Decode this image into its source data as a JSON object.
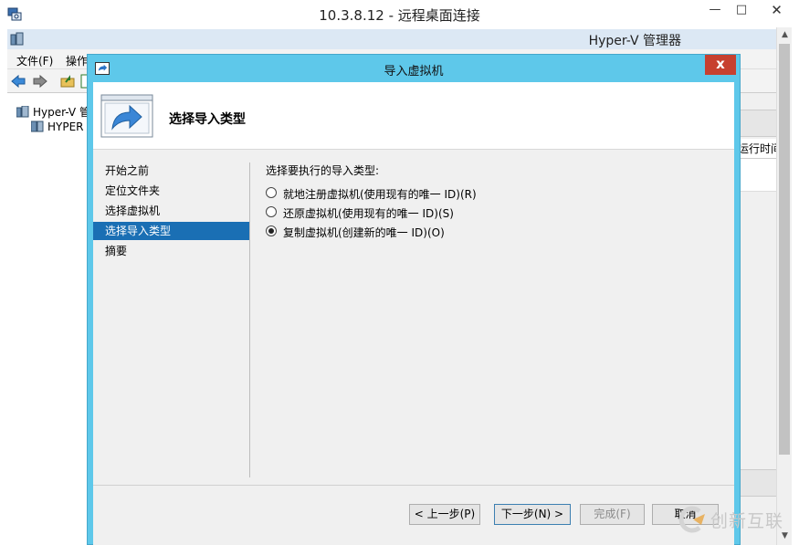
{
  "rdp": {
    "title": "10.3.8.12 - 远程桌面连接",
    "min": "▭",
    "max": "□",
    "close": "✕"
  },
  "manager": {
    "title": "Hyper-V 管理器",
    "menu": [
      "文件(F)",
      "操作"
    ],
    "tree": [
      "Hyper-V 管",
      "HYPER"
    ],
    "column_header": "运行时间"
  },
  "dialog": {
    "title": "导入虚拟机",
    "close": "x",
    "header_title": "选择导入类型",
    "steps": [
      "开始之前",
      "定位文件夹",
      "选择虚拟机",
      "选择导入类型",
      "摘要"
    ],
    "active_step": 3,
    "prompt": "选择要执行的导入类型:",
    "options": [
      {
        "label": "就地注册虚拟机(使用现有的唯一 ID)(R)",
        "checked": false
      },
      {
        "label": "还原虚拟机(使用现有的唯一 ID)(S)",
        "checked": false
      },
      {
        "label": "复制虚拟机(创建新的唯一 ID)(O)",
        "checked": true
      }
    ],
    "buttons": {
      "prev": "< 上一步(P)",
      "next": "下一步(N) >",
      "finish": "完成(F)",
      "cancel": "取消"
    }
  },
  "watermark": {
    "text": "创新互联"
  },
  "colors": {
    "dialog_frame": "#5ec8ea",
    "close_red": "#c7402f",
    "selected_step": "#1a6fb4"
  }
}
